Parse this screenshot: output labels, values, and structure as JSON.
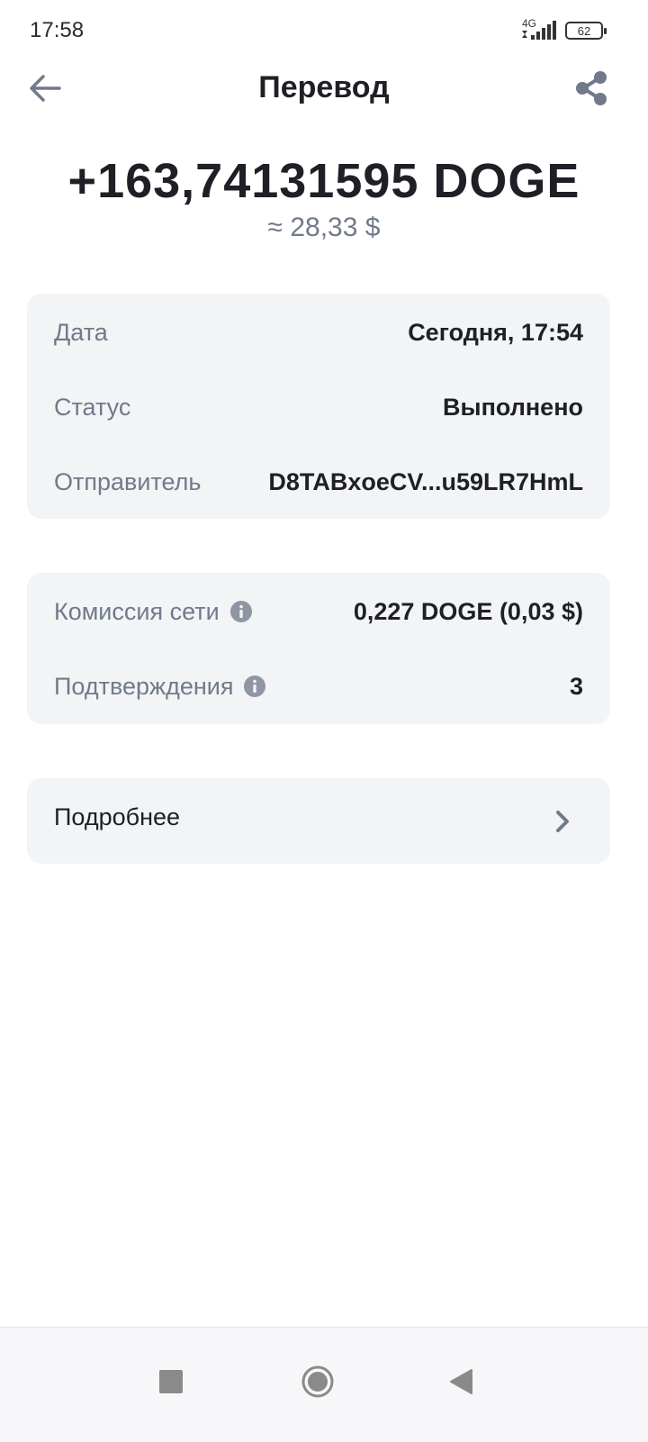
{
  "status_bar": {
    "time": "17:58",
    "network": "4G",
    "battery": "62"
  },
  "header": {
    "title": "Перевод",
    "back_icon": "arrow-left-icon",
    "share_icon": "share-icon"
  },
  "amount": {
    "main": "+163,74131595 DOGE",
    "fiat": "≈ 28,33 $"
  },
  "details_card": {
    "rows": [
      {
        "label": "Дата",
        "value": "Сегодня, 17:54"
      },
      {
        "label": "Статус",
        "value": "Выполнено"
      },
      {
        "label": "Отправитель",
        "value": "D8TABxoeCV...u59LR7HmL"
      }
    ]
  },
  "fee_card": {
    "rows": [
      {
        "label": "Комиссия сети",
        "value": "0,227 DOGE (0,03 $)"
      },
      {
        "label": "Подтверждения",
        "value": "3"
      }
    ]
  },
  "more": {
    "label": "Подробнее"
  },
  "nav_bar": {
    "icons": [
      "square-icon",
      "home-circle-icon",
      "back-triangle-icon"
    ]
  }
}
